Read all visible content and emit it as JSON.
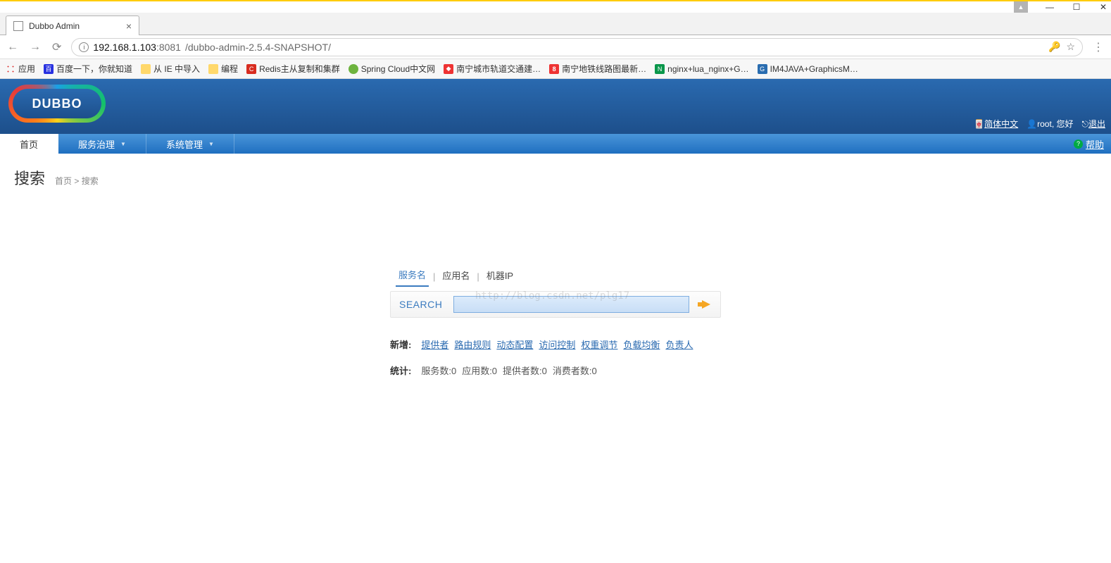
{
  "os": {
    "min": "—",
    "max": "☐",
    "close": "✕"
  },
  "tab": {
    "title": "Dubbo Admin"
  },
  "address": {
    "host": "192.168.1.103",
    "port": ":8081",
    "path": "/dubbo-admin-2.5.4-SNAPSHOT/"
  },
  "bookmarks": {
    "apps": "应用",
    "items": [
      "百度一下，你就知道",
      "从 IE 中导入",
      "编程",
      "Redis主从复制和集群",
      "Spring Cloud中文网",
      "南宁城市轨道交通建…",
      "南宁地铁线路图最新…",
      "nginx+lua_nginx+G…",
      "IM4JAVA+GraphicsM…"
    ]
  },
  "brand": "DUBBO",
  "header": {
    "lang": "简体中文",
    "user_prefix": "root",
    "user_greeting": ", 您好",
    "logout": "退出"
  },
  "nav": {
    "home": "首页",
    "service": "服务治理",
    "system": "系统管理",
    "help": "帮助"
  },
  "page": {
    "title": "搜索",
    "breadcrumb": "首页 > 搜索"
  },
  "search": {
    "tabs": [
      "服务名",
      "应用名",
      "机器IP"
    ],
    "label": "SEARCH",
    "value": ""
  },
  "add": {
    "label": "新增:",
    "links": [
      "提供者",
      "路由规则",
      "动态配置",
      "访问控制",
      "权重调节",
      "负载均衡",
      "负责人"
    ]
  },
  "stats": {
    "label": "统计:",
    "items": [
      "服务数:0",
      "应用数:0",
      "提供者数:0",
      "消费者数:0"
    ]
  },
  "watermark": "http://blog.csdn.net/plg17"
}
